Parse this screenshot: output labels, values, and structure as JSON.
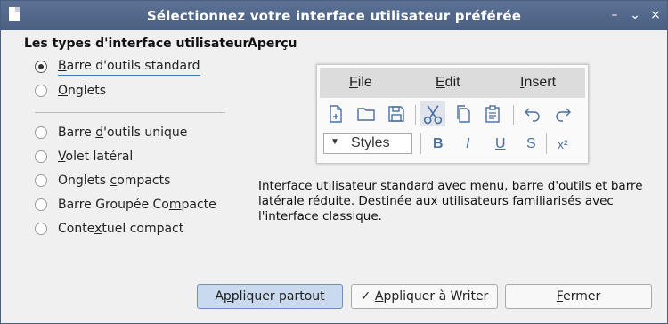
{
  "window": {
    "title": "Sélectionnez votre interface utilisateur préférée",
    "minimize": "–",
    "maximize": "⌄",
    "close": "×"
  },
  "left": {
    "section_title": "Les types d'interface utilisateur",
    "group1": [
      {
        "label": "Barre d'outils standard",
        "checked": true
      },
      {
        "label": "Onglets",
        "checked": false
      }
    ],
    "group2": [
      {
        "label": "Barre d'outils unique",
        "checked": false
      },
      {
        "label": "Volet latéral",
        "checked": false
      },
      {
        "label": "Onglets compacts",
        "checked": false
      },
      {
        "label": "Barre Groupée Compacte",
        "checked": false
      },
      {
        "label": "Contextuel compact",
        "checked": false
      }
    ]
  },
  "preview": {
    "section_title": "Aperçu",
    "menu": [
      "File",
      "Edit",
      "Insert"
    ],
    "styles_label": "Styles",
    "format": {
      "bold": "B",
      "italic": "I",
      "underline": "U",
      "strike": "S",
      "superscript": "x²"
    }
  },
  "description": "Interface utilisateur standard avec menu, barre d'outils et barre latérale réduite. Destinée aux utilisateurs familiarisés avec l'interface classique.",
  "buttons": {
    "apply_all": "Appliquer partout",
    "apply_writer": "Appliquer à Writer",
    "close": "Fermer"
  },
  "colors": {
    "accent": "#4b6fa3",
    "titlebar": "#5b7195",
    "primary_button": "#c9d9ee"
  }
}
